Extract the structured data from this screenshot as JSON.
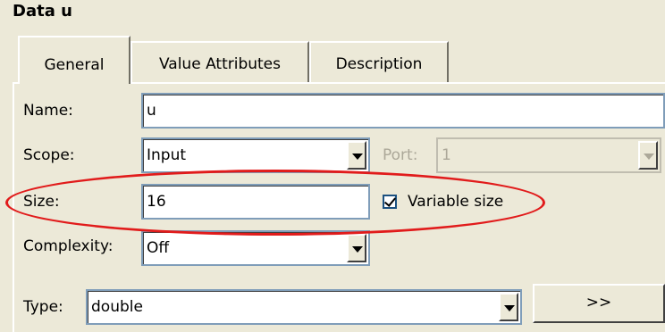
{
  "window": {
    "title": "Data u"
  },
  "tabs": [
    {
      "label": "General",
      "active": true
    },
    {
      "label": "Value Attributes",
      "active": false
    },
    {
      "label": "Description",
      "active": false
    }
  ],
  "form": {
    "name": {
      "label": "Name:",
      "value": "u"
    },
    "scope": {
      "label": "Scope:",
      "value": "Input"
    },
    "port": {
      "label": "Port:",
      "value": "1",
      "disabled": true
    },
    "size": {
      "label": "Size:",
      "value": "16"
    },
    "variable_size": {
      "label": "Variable size",
      "checked": true
    },
    "complexity": {
      "label": "Complexity:",
      "value": "Off"
    },
    "type": {
      "label": "Type:",
      "value": "double"
    },
    "expand_button": {
      "label": ">>"
    }
  },
  "annotation": {
    "color": "#e11b1b",
    "shape": "ellipse around Size row"
  }
}
